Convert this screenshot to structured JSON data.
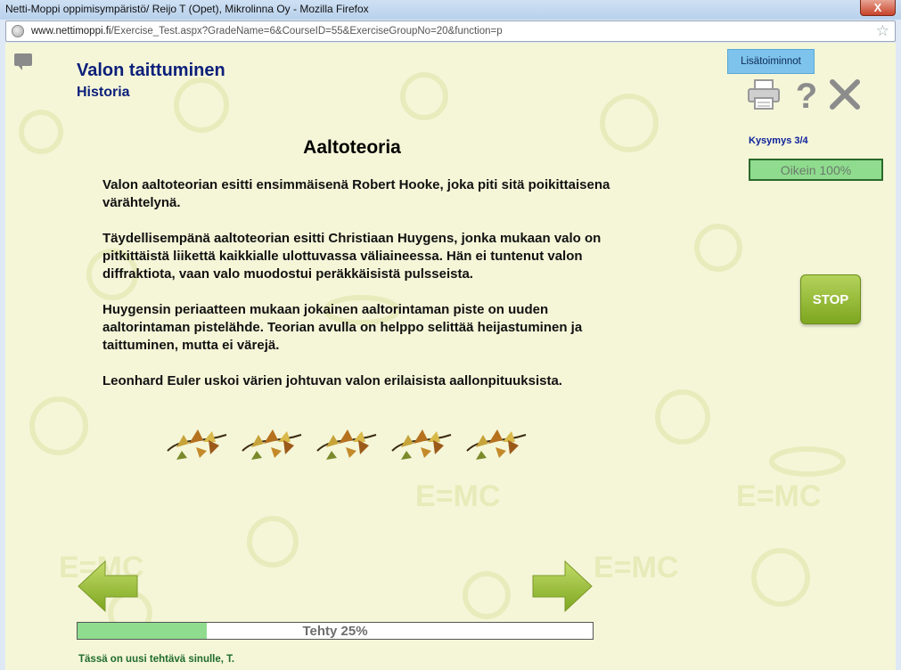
{
  "window": {
    "title": "Netti-Moppi oppimisympäristö/ Reijo T (Opet), Mikrolinna Oy - Mozilla Firefox",
    "url_host": "www.nettimoppi.fi",
    "url_path": "/Exercise_Test.aspx?GradeName=6&CourseID=55&ExerciseGroupNo=20&function=p",
    "close_label": "X"
  },
  "header": {
    "course_title": "Valon taittuminen",
    "subtitle": "Historia",
    "more_button": "Lisätoiminnot"
  },
  "tools": {
    "icons": [
      "printer-icon",
      "help-icon",
      "close-icon"
    ]
  },
  "progress": {
    "question_counter": "Kysymys 3/4",
    "correct_label": "Oikein 100%",
    "correct_fraction": 1.0,
    "done_label": "Tehty 25%",
    "done_fraction": 0.25
  },
  "stop_button": "STOP",
  "lesson": {
    "heading": "Aaltoteoria",
    "paragraphs": [
      "Valon aaltoteorian esitti ensimmäisenä Robert Hooke, joka piti sitä poikittaisena värähtelynä.",
      "Täydellisempänä aaltoteorian esitti Christiaan Huygens, jonka mukaan valo on pitkittäistä liikettä kaikkialle ulottuvassa väliaineessa. Hän ei tuntenut valon diffraktiota, vaan valo muodostui peräkkäisistä pulsseista.",
      "Huygensin periaatteen mukaan jokainen aaltorintaman piste on uuden aaltorintaman pistelähde. Teorian avulla on helppo selittää heijastuminen ja taittuminen, mutta ei värejä.",
      "Leonhard Euler uskoi värien johtuvan valon erilaisista aallonpituuksista."
    ]
  },
  "footer": {
    "status_message": "Tässä on uusi tehtävä sinulle, T."
  },
  "colors": {
    "title": "#0b1f7a",
    "progress_fill": "#8fdc8f",
    "stop_green": "#8fb52a",
    "status_green": "#1f6b2c"
  }
}
